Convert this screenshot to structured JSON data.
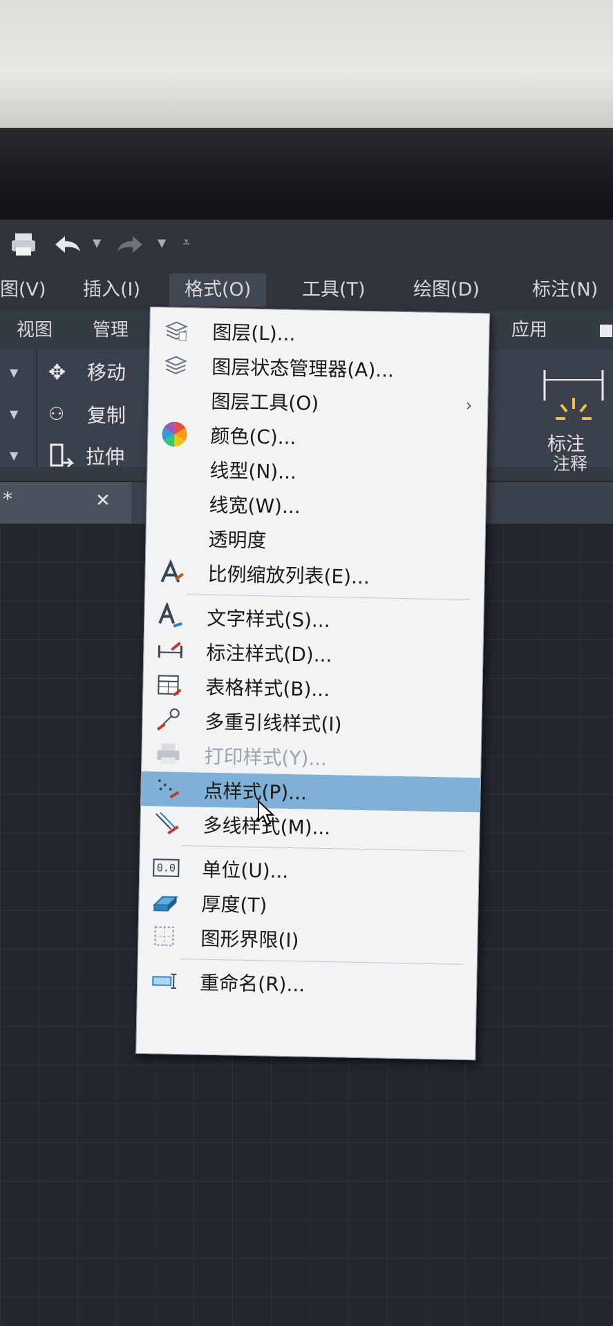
{
  "menubar": {
    "items": [
      "图(V)",
      "插入(I)",
      "格式(O)",
      "工具(T)",
      "绘图(D)",
      "标注(N)"
    ]
  },
  "ribbon_tabs": [
    "视图",
    "管理",
    "应用"
  ],
  "ribbon": {
    "move_label": "移动",
    "copy_label": "复制",
    "stretch_label": "拉伸",
    "dimension_label": "标注",
    "annotation_panel_label": "注释"
  },
  "document_tab": {
    "title": "*",
    "close": "✕"
  },
  "format_menu": {
    "items": [
      {
        "label": "图层(L)...",
        "icon": "layer-icon"
      },
      {
        "label": "图层状态管理器(A)...",
        "icon": "layer-state-icon"
      },
      {
        "label": "图层工具(O)",
        "icon": "",
        "submenu": "›"
      },
      {
        "label": "颜色(C)...",
        "icon": "color-wheel-icon"
      },
      {
        "label": "线型(N)...",
        "icon": ""
      },
      {
        "label": "线宽(W)...",
        "icon": ""
      },
      {
        "label": "透明度",
        "icon": ""
      },
      {
        "label": "比例缩放列表(E)...",
        "icon": "scale-list-icon"
      },
      {
        "label": "文字样式(S)...",
        "icon": "text-style-icon"
      },
      {
        "label": "标注样式(D)...",
        "icon": "dim-style-icon"
      },
      {
        "label": "表格样式(B)...",
        "icon": "table-style-icon"
      },
      {
        "label": "多重引线样式(I)",
        "icon": "mleader-style-icon"
      },
      {
        "label": "打印样式(Y)...",
        "icon": "plot-style-icon",
        "disabled": true
      },
      {
        "label": "点样式(P)...",
        "icon": "point-style-icon",
        "highlighted": true
      },
      {
        "label": "多线样式(M)...",
        "icon": "mline-style-icon"
      },
      {
        "label": "单位(U)...",
        "icon": "units-icon"
      },
      {
        "label": "厚度(T)",
        "icon": "thickness-icon"
      },
      {
        "label": "图形界限(I)",
        "icon": "limits-icon"
      },
      {
        "label": "重命名(R)...",
        "icon": "rename-icon"
      }
    ],
    "units_icon_text": "0.0"
  },
  "colors": {
    "highlight": "#7fb0d6",
    "menu_bg": "#f2f3f4",
    "app_bg": "#2f343d"
  }
}
